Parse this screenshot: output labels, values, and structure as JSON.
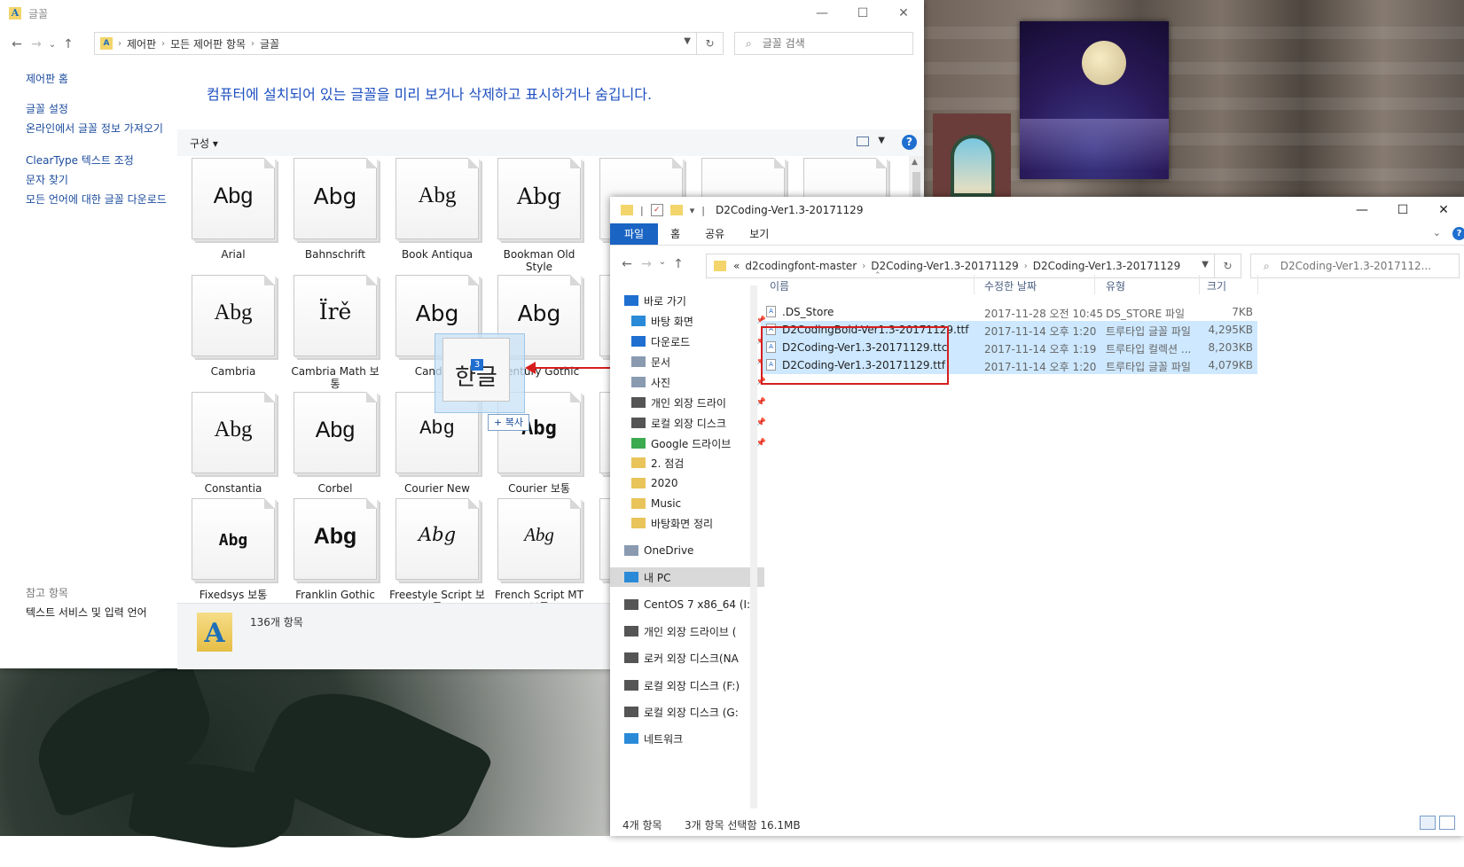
{
  "font_window": {
    "title": "글꼴",
    "app_icon": "A",
    "controls": {
      "minimize": "—",
      "maximize": "☐",
      "close": "✕"
    },
    "nav": {
      "back": "←",
      "forward": "→",
      "recent": "⌄",
      "up": "↑"
    },
    "breadcrumb": [
      "제어판",
      "모든 제어판 항목",
      "글꼴"
    ],
    "search_placeholder": "글꼴 검색",
    "left_pane": {
      "home": "제어판 홈",
      "links": [
        "글꼴 설정",
        "온라인에서 글꼴 정보 가져오기",
        "ClearType 텍스트 조정",
        "문자 찾기",
        "모든 언어에 대한 글꼴 다운로드"
      ],
      "see_also_title": "참고 항목",
      "see_also": "텍스트 서비스 및 입력 언어"
    },
    "heading": "컴퓨터에 설치되어 있는 글꼴을 미리 보거나 삭제하고 표시하거나 숨깁니다.",
    "organize": "구성",
    "help": "?",
    "fonts": [
      {
        "sample": "Abg",
        "name": "Arial"
      },
      {
        "sample": "Abg",
        "name": "Bahnschrift"
      },
      {
        "sample": "Abg",
        "name": "Book Antiqua"
      },
      {
        "sample": "Abg",
        "name": "Bookman Old Style"
      },
      {
        "sample": "",
        "name": ""
      },
      {
        "sample": "",
        "name": ""
      },
      {
        "sample": "",
        "name": ""
      },
      {
        "sample": "Abg",
        "name": "Cambria"
      },
      {
        "sample": "Ïrě",
        "name": "Cambria Math 보통"
      },
      {
        "sample": "Abg",
        "name": "Candara"
      },
      {
        "sample": "Abg",
        "name": "Century Gothic"
      },
      {
        "sample": "Abg",
        "name": "Constantia"
      },
      {
        "sample": "Abg",
        "name": "Corbel"
      },
      {
        "sample": "Abg",
        "name": "Courier New"
      },
      {
        "sample": "Abg",
        "name": "Courier 보통"
      },
      {
        "sample": "Abg",
        "name": "Fixedsys 보통"
      },
      {
        "sample": "Abg",
        "name": "Franklin Gothic"
      },
      {
        "sample": "Abg",
        "name": "Freestyle Script 보통"
      },
      {
        "sample": "Abg",
        "name": "French Script MT 보통"
      }
    ],
    "status_count": "136개 항목"
  },
  "drag": {
    "ghost_text": "한글",
    "badge": "3",
    "copy_tip": "+ 복사"
  },
  "explorer": {
    "title": "D2Coding-Ver1.3-20171129",
    "controls": {
      "minimize": "—",
      "maximize": "☐",
      "close": "✕"
    },
    "ribbon_tabs": [
      "파일",
      "홈",
      "공유",
      "보기"
    ],
    "address": [
      "«",
      "d2codingfont-master",
      "D2Coding-Ver1.3-20171129",
      "D2Coding-Ver1.3-20171129"
    ],
    "search_placeholder": "D2Coding-Ver1.3-2017112...",
    "nav_items": [
      {
        "label": "바로 가기",
        "icon": "star-icon",
        "color": "#1f6fd0",
        "pin": false
      },
      {
        "label": "바탕 화면",
        "icon": "desktop-icon",
        "color": "#2a8ad8",
        "pin": true
      },
      {
        "label": "다운로드",
        "icon": "download-icon",
        "color": "#1f6fd0",
        "pin": true
      },
      {
        "label": "문서",
        "icon": "document-icon",
        "color": "#8a9bb0",
        "pin": true
      },
      {
        "label": "사진",
        "icon": "picture-icon",
        "color": "#8a9bb0",
        "pin": true
      },
      {
        "label": "개인 외장 드라이",
        "icon": "drive-icon",
        "color": "#555555",
        "pin": true
      },
      {
        "label": "로컬 외장 디스크",
        "icon": "drive-icon",
        "color": "#555555",
        "pin": true
      },
      {
        "label": "Google 드라이브",
        "icon": "google-drive-icon",
        "color": "#3cab4f",
        "pin": true
      },
      {
        "label": "2. 점검",
        "icon": "folder-check-icon",
        "color": "#e8c45a",
        "pin": false
      },
      {
        "label": "2020",
        "icon": "folder-check-icon",
        "color": "#e8c45a",
        "pin": false
      },
      {
        "label": "Music",
        "icon": "folder-x-icon",
        "color": "#e8c45a",
        "pin": false
      },
      {
        "label": "바탕화면 정리",
        "icon": "folder-icon",
        "color": "#e8c45a",
        "pin": false
      },
      {
        "label": "OneDrive",
        "icon": "cloud-icon",
        "color": "#8a9bb0",
        "pin": false
      },
      {
        "label": "내 PC",
        "icon": "pc-icon",
        "color": "#2a8ad8",
        "pin": false
      },
      {
        "label": "CentOS 7 x86_64 (I:)",
        "icon": "usb-icon",
        "color": "#555555",
        "pin": false
      },
      {
        "label": "개인 외장 드라이브 (",
        "icon": "drive-icon",
        "color": "#555555",
        "pin": false
      },
      {
        "label": "로커 외장 디스크(NA",
        "icon": "drive-icon",
        "color": "#555555",
        "pin": false
      },
      {
        "label": "로컬 외장 디스크 (F:)",
        "icon": "drive-icon",
        "color": "#555555",
        "pin": false
      },
      {
        "label": "로컬 외장 디스크 (G:",
        "icon": "drive-icon",
        "color": "#555555",
        "pin": false
      },
      {
        "label": "네트워크",
        "icon": "network-icon",
        "color": "#2a8ad8",
        "pin": false
      }
    ],
    "columns": {
      "name": "이름",
      "date": "수정한 날짜",
      "type": "유형",
      "size": "크기"
    },
    "files": [
      {
        "name": ".DS_Store",
        "date": "2017-11-28 오전 10:45",
        "type": "DS_STORE 파일",
        "size": "7KB",
        "selected": false
      },
      {
        "name": "D2CodingBold-Ver1.3-20171129.ttf",
        "date": "2017-11-14 오후 1:20",
        "type": "트루타입 글꼴 파일",
        "size": "4,295KB",
        "selected": true
      },
      {
        "name": "D2Coding-Ver1.3-20171129.ttc",
        "date": "2017-11-14 오후 1:19",
        "type": "트루타입 컬렉션 ...",
        "size": "8,203KB",
        "selected": true
      },
      {
        "name": "D2Coding-Ver1.3-20171129.ttf",
        "date": "2017-11-14 오후 1:20",
        "type": "트루타입 글꼴 파일",
        "size": "4,079KB",
        "selected": true
      }
    ],
    "status_items": "4개 항목",
    "status_selected": "3개 항목 선택함 16.1MB"
  }
}
